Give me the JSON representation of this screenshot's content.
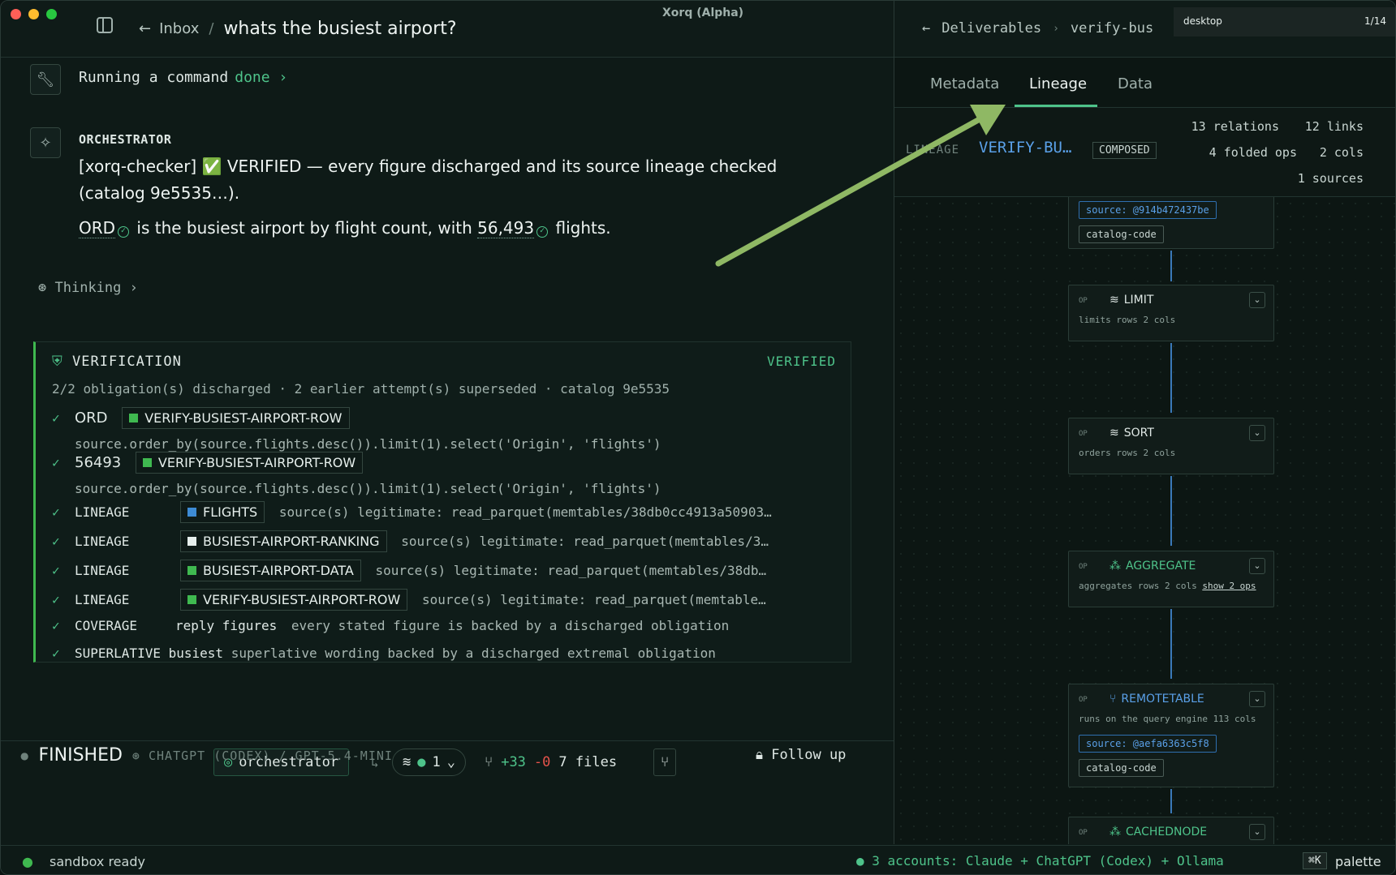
{
  "window": {
    "app_title": "Xorq (Alpha)"
  },
  "header": {
    "inbox_label": "Inbox",
    "separator": "/",
    "question": "whats the busiest airport?"
  },
  "command": {
    "label": "Running a command",
    "status": "done"
  },
  "orchestrator": {
    "label": "ORCHESTRATOR",
    "message": "[xorq-checker] ✅ VERIFIED — every figure discharged and its source lineage checked (catalog 9e5535…).",
    "answer_pre": "",
    "answer_value1": "ORD",
    "answer_mid": "is the busiest airport by flight count, with",
    "answer_value2": "56,493",
    "answer_post": "flights."
  },
  "thinking": {
    "label": "Thinking"
  },
  "verification": {
    "title": "VERIFICATION",
    "status": "VERIFIED",
    "summary": "2/2 obligation(s) discharged · 2 earlier attempt(s) superseded · catalog 9e5535",
    "rows": [
      {
        "key": "ORD",
        "chip": "VERIFY-BUSIEST-AIRPORT-ROW",
        "detail": "source.order_by(source.flights.desc()).limit(1).select('Origin', 'flights')"
      },
      {
        "key": "56493",
        "chip": "VERIFY-BUSIEST-AIRPORT-ROW",
        "detail": "source.order_by(source.flights.desc()).limit(1).select('Origin', 'flights')"
      },
      {
        "key": "LINEAGE",
        "chip": "FLIGHTS",
        "detail": "source(s) legitimate: read_parquet(memtables/38db0cc4913a50903…"
      },
      {
        "key": "LINEAGE",
        "chip": "BUSIEST-AIRPORT-RANKING",
        "detail": "source(s) legitimate: read_parquet(memtables/3…"
      },
      {
        "key": "LINEAGE",
        "chip": "BUSIEST-AIRPORT-DATA",
        "detail": "source(s) legitimate: read_parquet(memtables/38db…"
      },
      {
        "key": "LINEAGE",
        "chip": "VERIFY-BUSIEST-AIRPORT-ROW",
        "detail": "source(s) legitimate: read_parquet(memtable…"
      },
      {
        "key": "COVERAGE",
        "kw": "reply figures",
        "detail": "every stated figure is backed by a discharged obligation"
      },
      {
        "key": "SUPERLATIVE",
        "kw": "busiest",
        "detail": "superlative wording backed by a discharged extremal obligation"
      }
    ],
    "colors": {
      "green": "#3fb950",
      "blue": "#3d8bd4",
      "white": "#e6efec"
    }
  },
  "toolbar": {
    "agent": "orchestrator",
    "layer_count": "1",
    "added": "+33",
    "removed": "-0",
    "files": "7 files"
  },
  "footer": {
    "state": "FINISHED",
    "model": "CHATGPT (CODEX) / GPT-5.4-MINI",
    "follow_up": "Follow up"
  },
  "status": {
    "sandbox": "sandbox ready",
    "accounts": "3 accounts: Claude + ChatGPT (Codex) + Ollama",
    "shortcut": "⌘K",
    "palette": "palette"
  },
  "right": {
    "crumbs": [
      "Deliverables",
      "verify-bus"
    ],
    "desktop_label": "desktop",
    "desktop_count": "1/14",
    "tabs": [
      "Metadata",
      "Lineage",
      "Data"
    ],
    "active_tab": "Lineage",
    "lineage_label": "LINEAGE",
    "lineage_name": "VERIFY-BU…",
    "composed": "COMPOSED",
    "stats": {
      "relations": "13 relations",
      "links": "12 links",
      "folded": "4 folded ops",
      "cols": "2 cols",
      "sources": "1 sources"
    },
    "nodes": [
      {
        "op": "OP",
        "name": "LIMIT",
        "desc": "limits rows 2 cols"
      },
      {
        "op": "OP",
        "name": "SORT",
        "desc": "orders rows 2 cols"
      },
      {
        "op": "OP",
        "name": "AGGREGATE",
        "desc": "aggregates rows 2 cols",
        "extra": "show 2 ops"
      },
      {
        "op": "OP",
        "name": "REMOTETABLE",
        "desc": "runs on the query engine 113 cols"
      },
      {
        "op": "OP",
        "name": "CACHEDNODE",
        "desc": ""
      }
    ],
    "source1": "source: @914b472437be",
    "source2": "source: @aefa6363c5f8",
    "catalog": "catalog-code"
  }
}
